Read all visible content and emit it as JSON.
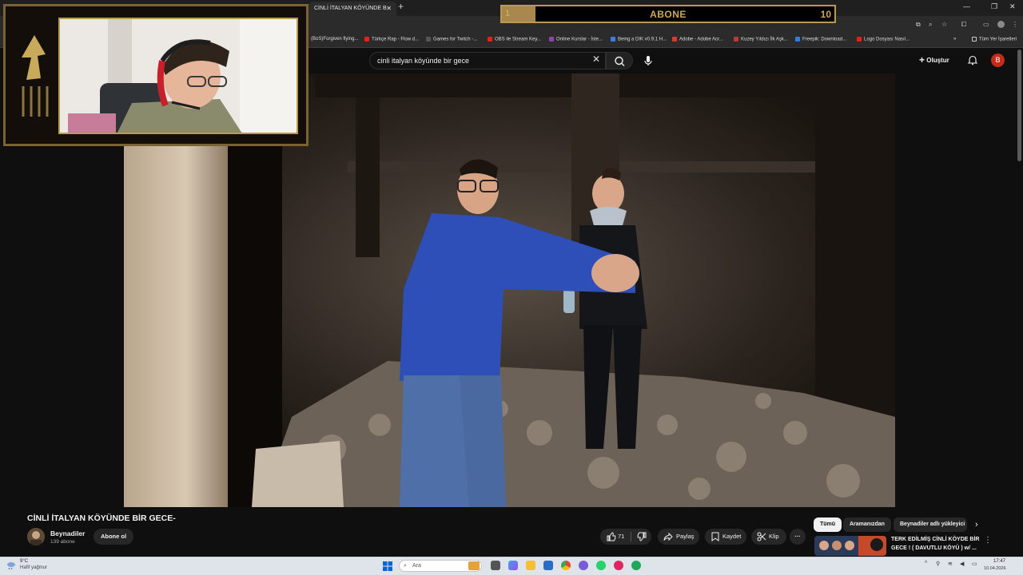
{
  "browser": {
    "tab_title": "CİNLİ İTALYAN KÖYÜNDE B",
    "bookmarks": [
      {
        "label": "(BoS)Forgiven flying...",
        "color": "#7a7a7a"
      },
      {
        "label": "Türkçe Rap - Flow d...",
        "color": "#e62117"
      },
      {
        "label": "Games for Twitch -...",
        "color": "#555555"
      },
      {
        "label": "OBS ile Stream Key...",
        "color": "#e62117"
      },
      {
        "label": "Online Kurslar - İste...",
        "color": "#8e44ad"
      },
      {
        "label": "Being a DIK v0.9.1 H...",
        "color": "#3b7de0"
      },
      {
        "label": "Adobe - Adobe Acr...",
        "color": "#d83b2b"
      },
      {
        "label": "Kuzey Yıldızı İlk Aşk...",
        "color": "#c0392b"
      },
      {
        "label": "Freepik: Download...",
        "color": "#2f7de1"
      },
      {
        "label": "Logo Dosyası Nasıl...",
        "color": "#e62117"
      }
    ],
    "bookmarks_overflow": "»",
    "all_bookmarks": "Tüm Yer İşaretleri"
  },
  "overlay": {
    "sub_goal_label": "ABONE",
    "sub_current": "1",
    "sub_goal": "10",
    "progress_fraction": 0.1,
    "accent": "#b99a52"
  },
  "youtube": {
    "search_query": "cinli italyan köyünde bir gece",
    "create_label": "Oluştur",
    "user_initial": "B",
    "video_title": "CİNLİ İTALYAN KÖYÜNDE BİR GECE-",
    "channel_name": "Beynadiler",
    "channel_subs": "139 abone",
    "subscribe_label": "Abone ol",
    "like_count": "71",
    "share_label": "Paylaş",
    "save_label": "Kaydet",
    "clip_label": "Klip",
    "chips": [
      "Tümü",
      "Aramanızdan",
      "Beynadiler adlı yükleyici"
    ],
    "rec_title_line1": "TERK EDİLMİŞ CİNLİ KÖYDE BİR",
    "rec_title_line2": "GECE ! ( DAVUTLU KÖYÜ ) w/ ..."
  },
  "taskbar": {
    "weather_temp": "9°C",
    "weather_desc": "Hafif yağmur",
    "search_placeholder": "Ara",
    "time": "17:47",
    "date": "10.04.2026"
  }
}
